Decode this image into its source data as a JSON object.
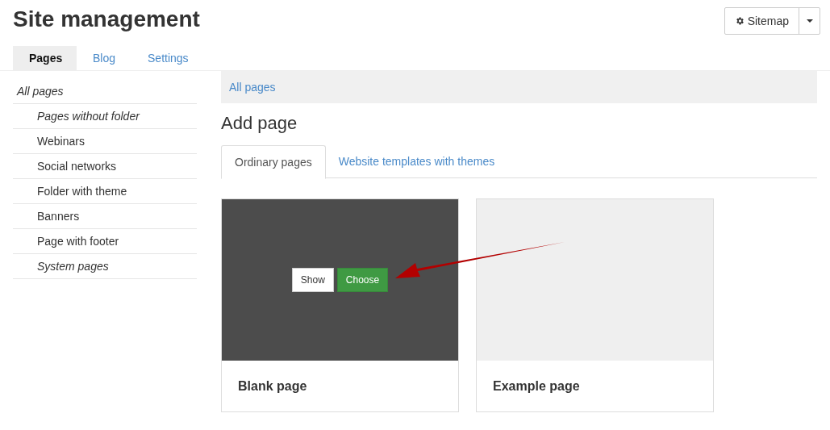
{
  "title": "Site management",
  "sitemap_button": {
    "label": "Sitemap"
  },
  "tabs": [
    {
      "label": "Pages",
      "selected": true
    },
    {
      "label": "Blog",
      "selected": false
    },
    {
      "label": "Settings",
      "selected": false
    }
  ],
  "sidebar": {
    "items": [
      {
        "label": "All pages",
        "italic": true,
        "children": [
          {
            "label": "Pages without folder",
            "italic": true
          },
          {
            "label": "Webinars",
            "italic": false
          },
          {
            "label": "Social networks",
            "italic": false
          },
          {
            "label": "Folder with theme",
            "italic": false
          },
          {
            "label": "Banners",
            "italic": false
          },
          {
            "label": "Page with footer",
            "italic": false
          },
          {
            "label": "System pages",
            "italic": true
          }
        ]
      }
    ]
  },
  "breadcrumb": "All pages",
  "heading": "Add page",
  "page_tabs": [
    {
      "label": "Ordinary pages",
      "selected": true
    },
    {
      "label": "Website templates with themes",
      "selected": false
    }
  ],
  "cards": [
    {
      "title": "Blank page",
      "hovered": true,
      "buttons": [
        {
          "label": "Show",
          "kind": "secondary"
        },
        {
          "label": "Choose",
          "kind": "primary"
        }
      ]
    },
    {
      "title": "Example page",
      "hovered": false
    }
  ]
}
